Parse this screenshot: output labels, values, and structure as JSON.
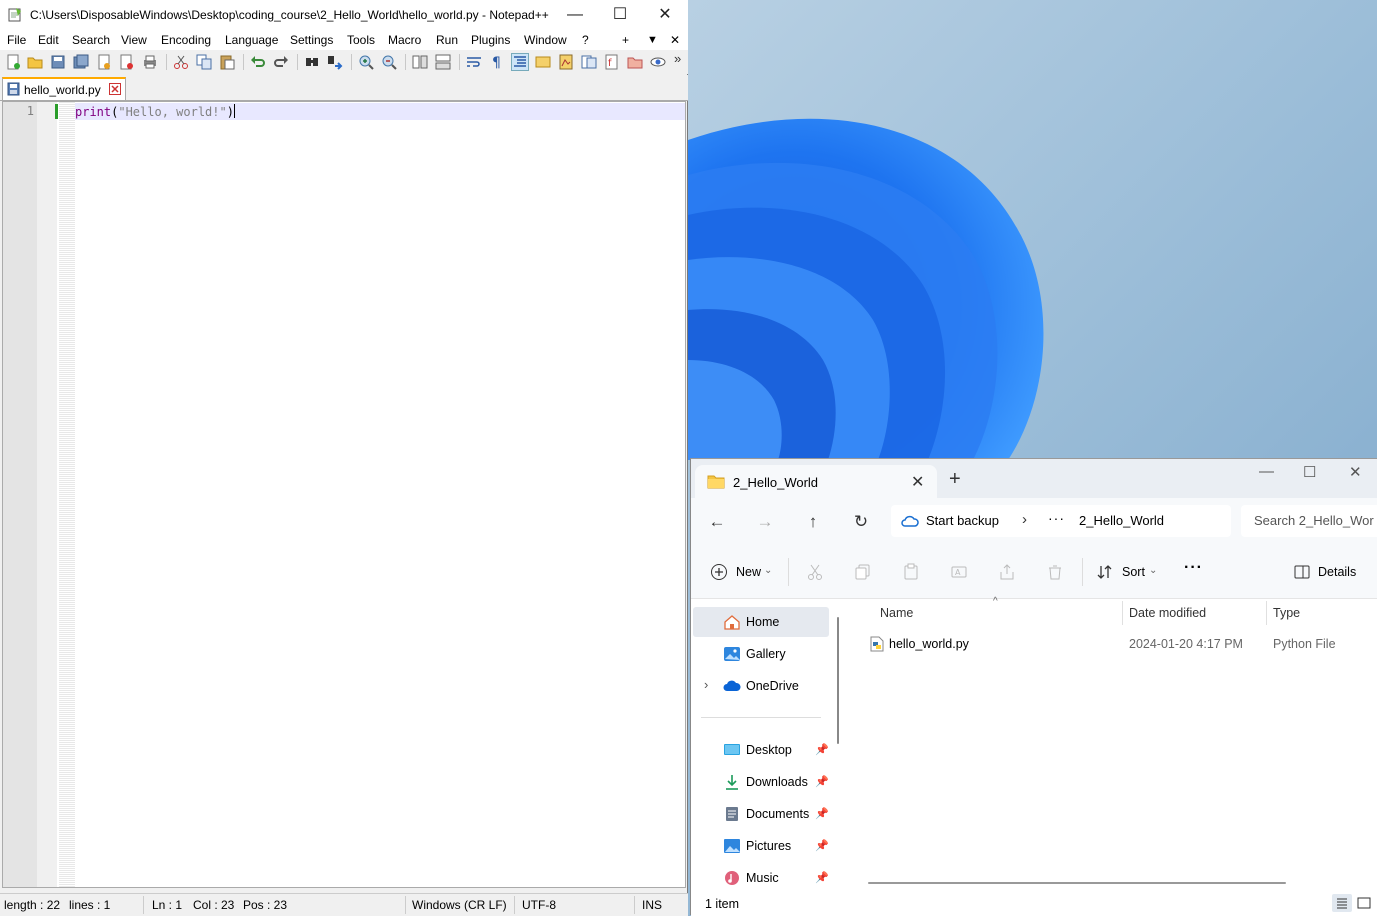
{
  "notepadpp": {
    "title": "C:\\Users\\DisposableWindows\\Desktop\\coding_course\\2_Hello_World\\hello_world.py - Notepad++",
    "window_controls": {
      "minimize": "—",
      "maximize": "☐",
      "close": "✕"
    },
    "menu": [
      "File",
      "Edit",
      "Search",
      "View",
      "Encoding",
      "Language",
      "Settings",
      "Tools",
      "Macro",
      "Run",
      "Plugins",
      "Window",
      "?"
    ],
    "menu_extra": {
      "plus": "+",
      "down": "▼",
      "close": "✕"
    },
    "toolbar_overflow": "»",
    "tab": {
      "label": "hello_world.py"
    },
    "editor": {
      "line_number": "1",
      "code": {
        "keyword": "print",
        "open_paren": "(",
        "string": "\"Hello, world!\"",
        "close_paren": ")"
      }
    },
    "status": {
      "length": "length : 22",
      "lines": "lines : 1",
      "ln": "Ln : 1",
      "col": "Col : 23",
      "pos": "Pos : 23",
      "eol": "Windows (CR LF)",
      "encoding": "UTF-8",
      "mode": "INS"
    }
  },
  "explorer": {
    "tab_title": "2_Hello_World",
    "tab_close": "✕",
    "new_tab": "+",
    "window_controls": {
      "minimize": "—",
      "maximize": "☐",
      "close": "✕"
    },
    "nav": {
      "back": "←",
      "forward": "→",
      "up": "↑",
      "refresh": "↻"
    },
    "address": {
      "backup": "Start backup",
      "chevron": "›",
      "overflow": "···",
      "current": "2_Hello_World"
    },
    "search_placeholder": "Search 2_Hello_Wor",
    "commands": {
      "new": "New",
      "new_caret": "⌄",
      "sort": "Sort",
      "sort_caret": "⌄",
      "more": "···",
      "details": "Details"
    },
    "sidebar": [
      {
        "label": "Home",
        "icon": "home-icon",
        "selected": true
      },
      {
        "label": "Gallery",
        "icon": "gallery-icon"
      },
      {
        "label": "OneDrive",
        "icon": "onedrive-icon",
        "expand": "›"
      },
      {
        "label": "Desktop",
        "icon": "desktop-icon",
        "pin": "📌"
      },
      {
        "label": "Downloads",
        "icon": "downloads-icon",
        "pin": "📌"
      },
      {
        "label": "Documents",
        "icon": "documents-icon",
        "pin": "📌"
      },
      {
        "label": "Pictures",
        "icon": "pictures-icon",
        "pin": "📌"
      },
      {
        "label": "Music",
        "icon": "music-icon",
        "pin": "📌"
      }
    ],
    "columns": {
      "name": "Name",
      "date": "Date modified",
      "type": "Type",
      "sort_indicator": "^"
    },
    "files": [
      {
        "name": "hello_world.py",
        "date": "2024-01-20 4:17 PM",
        "type": "Python File"
      }
    ],
    "status": {
      "count": "1 item"
    }
  }
}
